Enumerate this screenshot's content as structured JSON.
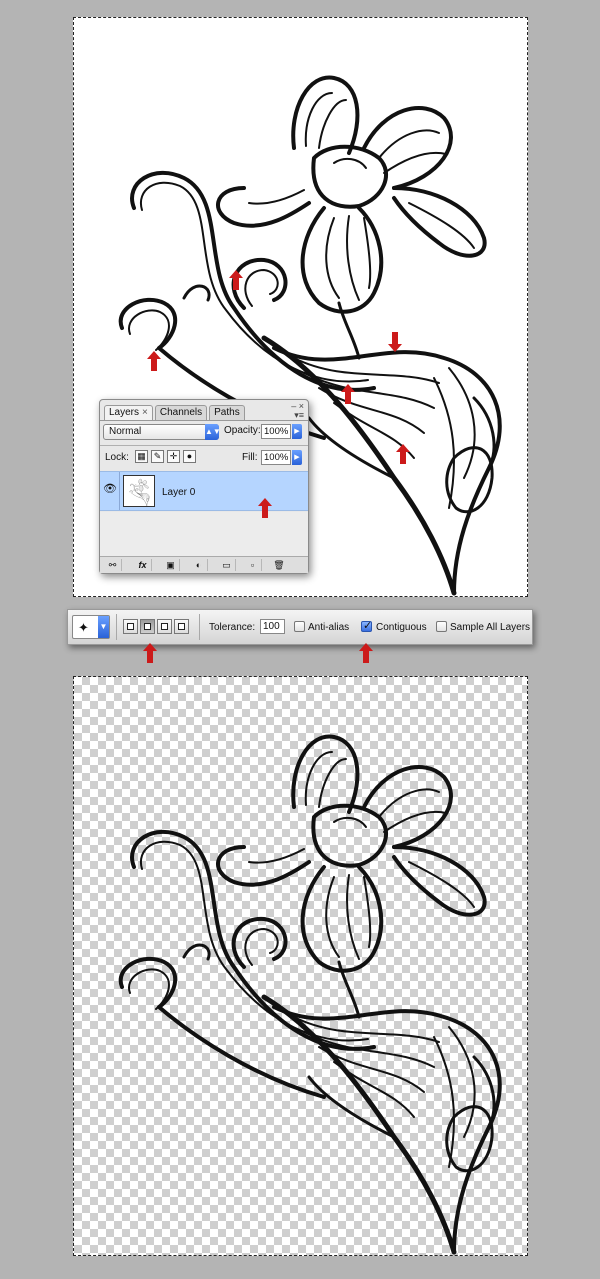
{
  "layers_panel": {
    "tabs": [
      {
        "label": "Layers",
        "close": "×"
      },
      {
        "label": "Channels"
      },
      {
        "label": "Paths"
      }
    ],
    "blend_mode": "Normal",
    "opacity_label": "Opacity:",
    "opacity_value": "100%",
    "lock_label": "Lock:",
    "fill_label": "Fill:",
    "fill_value": "100%",
    "layer": {
      "name": "Layer 0",
      "visible": true,
      "selected": true
    },
    "bottom_buttons": [
      "link-icon",
      "fx-icon",
      "mask-icon",
      "adjustment-icon",
      "folder-icon",
      "new-layer-icon",
      "trash-icon"
    ],
    "fx_label": "fx"
  },
  "options_bar": {
    "tool": "magic-wand-icon",
    "selection_modes": [
      "new-selection",
      "add-to-selection",
      "subtract-from-selection",
      "intersect-selection"
    ],
    "active_mode": "add-to-selection",
    "tolerance_label": "Tolerance:",
    "tolerance_value": "100",
    "anti_alias_label": "Anti-alias",
    "anti_alias_checked": false,
    "contiguous_label": "Contiguous",
    "contiguous_checked": true,
    "sample_all_label": "Sample All Layers",
    "sample_all_checked": false
  },
  "annotation_color": "#cc1a1a"
}
